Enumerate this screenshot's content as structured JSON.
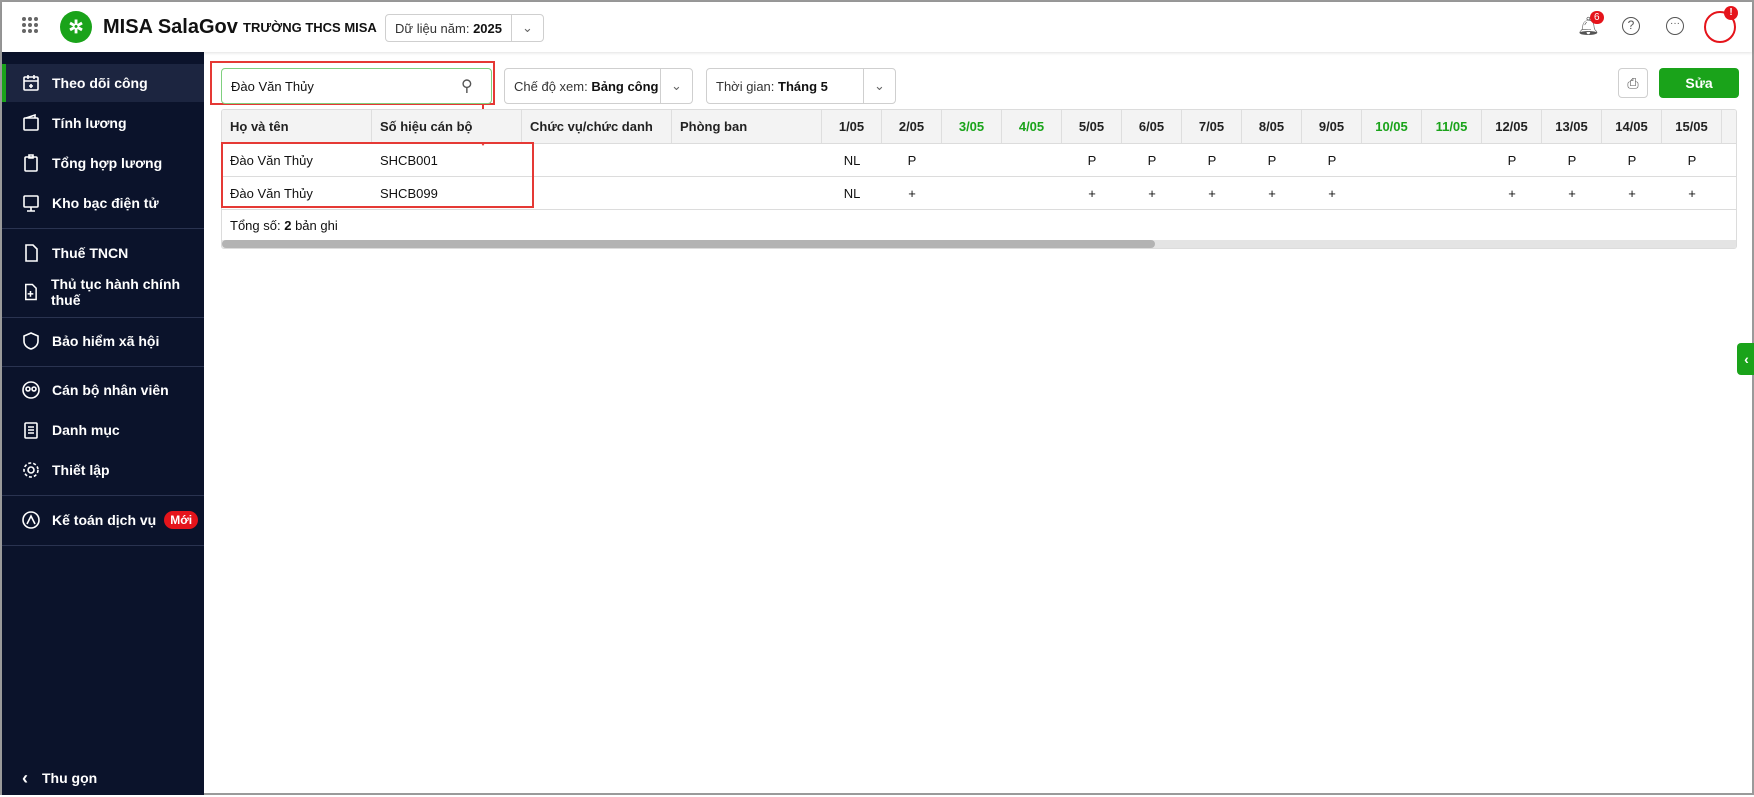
{
  "header": {
    "app_name": "MISA SalaGov",
    "org": "TRƯỜNG THCS MISA",
    "year_label": "Dữ liệu năm:",
    "year_value": "2025",
    "notification_count": "6",
    "avatar_alert": "!"
  },
  "sidebar": {
    "items": [
      {
        "label": "Theo dõi công",
        "icon": "calendar-icon"
      },
      {
        "label": "Tính lương",
        "icon": "wallet-icon"
      },
      {
        "label": "Tổng hợp lương",
        "icon": "clipboard-dollar-icon"
      },
      {
        "label": "Kho bạc điện tử",
        "icon": "monitor-dollar-icon"
      },
      {
        "label": "Thuế TNCN",
        "icon": "tax-document-icon"
      },
      {
        "label": "Thủ tục hành chính thuế",
        "icon": "document-plus-icon"
      },
      {
        "label": "Bảo hiểm xã hội",
        "icon": "shield-heart-icon"
      },
      {
        "label": "Cán bộ nhân viên",
        "icon": "people-icon"
      },
      {
        "label": "Danh mục",
        "icon": "list-icon"
      },
      {
        "label": "Thiết lập",
        "icon": "gear-icon"
      },
      {
        "label": "Kế toán dịch vụ",
        "icon": "service-icon",
        "badge": "Mới"
      }
    ],
    "collapse": "Thu gọn"
  },
  "toolbar": {
    "search_value": "Đào Văn Thủy",
    "view_label": "Chế độ xem:",
    "view_value": "Bảng công",
    "time_label": "Thời gian:",
    "time_value": "Tháng 5",
    "edit": "Sửa"
  },
  "table": {
    "columns": [
      "Họ và tên",
      "Số hiệu cán bộ",
      "Chức vụ/chức danh",
      "Phòng ban"
    ],
    "days": [
      "1/05",
      "2/05",
      "3/05",
      "4/05",
      "5/05",
      "6/05",
      "7/05",
      "8/05",
      "9/05",
      "10/05",
      "11/05",
      "12/05",
      "13/05",
      "14/05",
      "15/05"
    ],
    "weekend_days": [
      "3/05",
      "4/05",
      "10/05",
      "11/05"
    ],
    "rows": [
      {
        "name": "Đào Văn Thủy",
        "code": "SHCB001",
        "title": "",
        "dept": "",
        "marks": [
          "NL",
          "P",
          "",
          "",
          "P",
          "P",
          "P",
          "P",
          "P",
          "",
          "",
          "P",
          "P",
          "P",
          "P"
        ]
      },
      {
        "name": "Đào Văn Thủy",
        "code": "SHCB099",
        "title": "",
        "dept": "",
        "marks": [
          "NL",
          "+",
          "",
          "",
          "+",
          "+",
          "+",
          "+",
          "+",
          "",
          "",
          "+",
          "+",
          "+",
          "+"
        ]
      }
    ],
    "total_label": "Tổng số:",
    "total_count": "2",
    "total_suffix": "bản ghi"
  },
  "colors": {
    "accent": "#1aa31a",
    "sidebar": "#0b132b",
    "highlight": "#e53935"
  }
}
